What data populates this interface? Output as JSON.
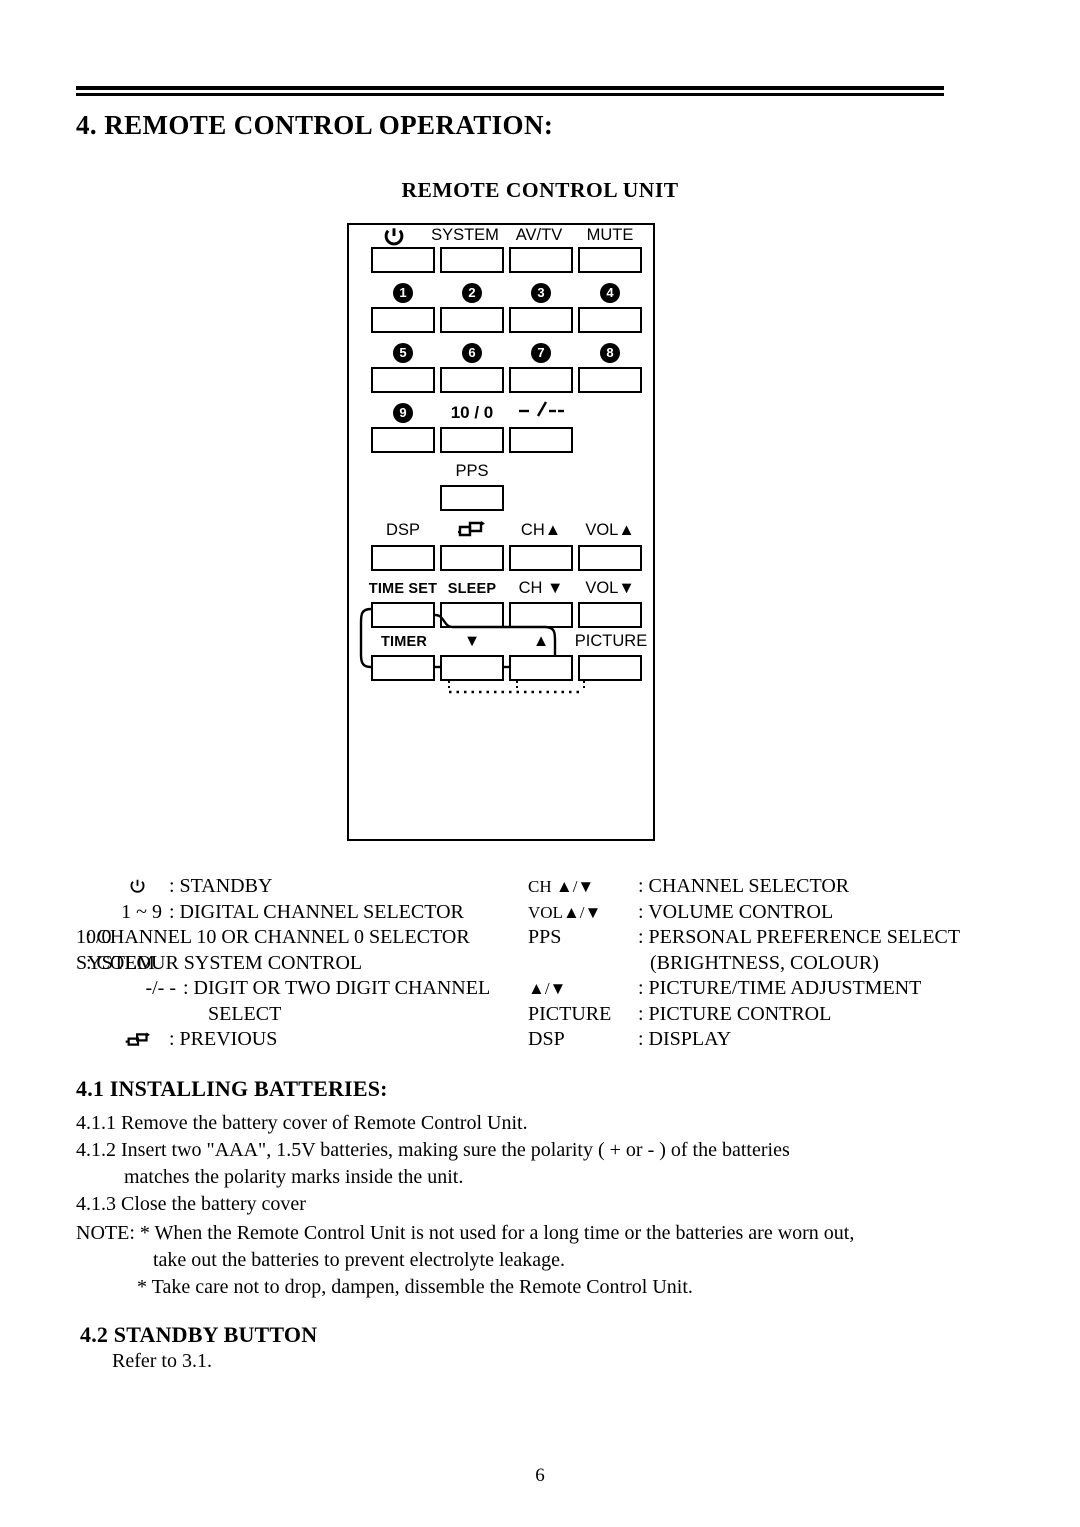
{
  "page": {
    "section_heading": "4. REMOTE CONTROL OPERATION:",
    "figure_title": "REMOTE CONTROL UNIT",
    "page_number": "6"
  },
  "remote": {
    "buttons": [
      {
        "label": "",
        "icon": "power-icon",
        "row": 1,
        "col": 1
      },
      {
        "label": "SYSTEM",
        "row": 1,
        "col": 2
      },
      {
        "label": "AV/TV",
        "row": 1,
        "col": 3
      },
      {
        "label": "MUTE",
        "row": 1,
        "col": 4
      },
      {
        "label": "1",
        "style": "circle",
        "row": 2,
        "col": 1
      },
      {
        "label": "2",
        "style": "circle",
        "row": 2,
        "col": 2
      },
      {
        "label": "3",
        "style": "circle",
        "row": 2,
        "col": 3
      },
      {
        "label": "4",
        "style": "circle",
        "row": 2,
        "col": 4
      },
      {
        "label": "5",
        "style": "circle",
        "row": 3,
        "col": 1
      },
      {
        "label": "6",
        "style": "circle",
        "row": 3,
        "col": 2
      },
      {
        "label": "7",
        "style": "circle",
        "row": 3,
        "col": 3
      },
      {
        "label": "8",
        "style": "circle",
        "row": 3,
        "col": 4
      },
      {
        "label": "9",
        "style": "circle",
        "row": 4,
        "col": 1
      },
      {
        "label": "10 / 0",
        "row": 4,
        "col": 2
      },
      {
        "label": "",
        "icon": "dash-slash-icon",
        "row": 4,
        "col": 3
      },
      {
        "label": "PPS",
        "row": 5,
        "col": 2
      },
      {
        "label": "DSP",
        "row": 6,
        "col": 1
      },
      {
        "label": "",
        "icon": "previous-loop-icon",
        "row": 6,
        "col": 2
      },
      {
        "label": "CH▲",
        "row": 6,
        "col": 3
      },
      {
        "label": "VOL▲",
        "row": 6,
        "col": 4
      },
      {
        "label": "TIME SET",
        "row": 7,
        "col": 1
      },
      {
        "label": "SLEEP",
        "row": 7,
        "col": 2
      },
      {
        "label": "CH ▼",
        "row": 7,
        "col": 3
      },
      {
        "label": "VOL▼",
        "row": 7,
        "col": 4
      },
      {
        "label": "TIMER",
        "row": 8,
        "col": 1
      },
      {
        "label": "▼",
        "row": 8,
        "col": 2
      },
      {
        "label": "▲",
        "row": 8,
        "col": 3
      },
      {
        "label": "PICTURE",
        "row": 8,
        "col": 4
      }
    ],
    "labels": {
      "power": "",
      "system": "SYSTEM",
      "avtv": "AV/TV",
      "mute": "MUTE",
      "n1": "1",
      "n2": "2",
      "n3": "3",
      "n4": "4",
      "n5": "5",
      "n6": "6",
      "n7": "7",
      "n8": "8",
      "n9": "9",
      "ten_zero": "10 / 0",
      "pps": "PPS",
      "dsp": "DSP",
      "ch_up": "CH▲",
      "vol_up": "VOL▲",
      "time_set": "TIME SET",
      "sleep": "SLEEP",
      "ch_down": "CH ▼",
      "vol_down": "VOL▼",
      "timer": "TIMER",
      "adj_down": "▼",
      "adj_up": "▲",
      "picture": "PICTURE"
    }
  },
  "legend": {
    "left": [
      {
        "key": "",
        "icon": "power-icon",
        "value": ": STANDBY"
      },
      {
        "key": "1 ~  9",
        "value": ": DIGITAL CHANNEL SELECTOR"
      },
      {
        "key": "10/0",
        "value": ": CHANNEL 10 OR CHANNEL 0 SELECTOR"
      },
      {
        "key": "SYSTEM",
        "value": ": COLOUR SYSTEM CONTROL"
      },
      {
        "key": "-/- -",
        "value": ": DIGIT OR TWO DIGIT CHANNEL"
      },
      {
        "key": "",
        "value": "SELECT"
      },
      {
        "key": "",
        "icon": "previous-loop-icon",
        "value": ": PREVIOUS"
      }
    ],
    "right": [
      {
        "key": "CH  ▲/▼",
        "value": ": CHANNEL SELECTOR"
      },
      {
        "key": "VOL▲/▼",
        "value": ": VOLUME CONTROL"
      },
      {
        "key": "PPS",
        "value": ": PERSONAL PREFERENCE SELECT"
      },
      {
        "key": "",
        "value": "(BRIGHTNESS, COLOUR)"
      },
      {
        "key": "▲/▼",
        "value": ": PICTURE/TIME ADJUSTMENT"
      },
      {
        "key": "PICTURE",
        "value": ": PICTURE CONTROL"
      },
      {
        "key": "DSP",
        "value": ": DISPLAY"
      }
    ]
  },
  "batteries": {
    "heading": "4.1 INSTALLING BATTERIES:",
    "line1": "4.1.1 Remove the battery cover of Remote Control Unit.",
    "line2": "4.1.2 Insert two \"AAA\", 1.5V batteries, making sure the polarity ( + or - ) of the batteries",
    "line3": "matches the polarity marks inside the unit.",
    "line4": "4.1.3 Close the battery cover",
    "note1": "NOTE: * When the Remote Control Unit is not used for a long time or the batteries are worn out,",
    "note2": "take out the batteries to prevent electrolyte leakage.",
    "note3": "* Take care not to drop, dampen, dissemble the Remote Control Unit."
  },
  "standby": {
    "heading": "4.2 STANDBY BUTTON",
    "body": "Refer to 3.1."
  }
}
